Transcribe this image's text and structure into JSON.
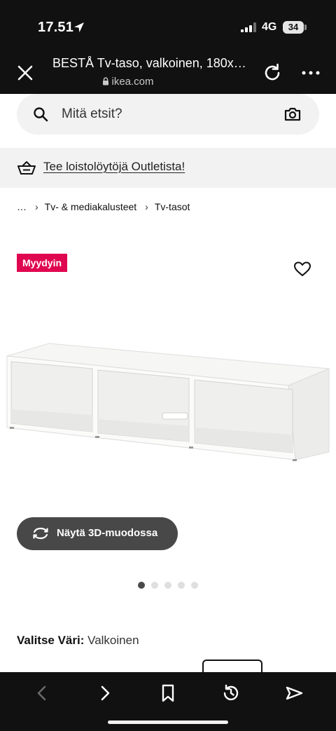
{
  "status_bar": {
    "time": "17.51",
    "network": "4G",
    "battery": "34"
  },
  "browser": {
    "title": "BESTÅ Tv-taso, valkoinen, 180x…",
    "domain": "ikea.com"
  },
  "search": {
    "placeholder": "Mitä etsit?"
  },
  "outlet_banner": {
    "text": "Tee loistolöytöjä Outletista!"
  },
  "breadcrumb": [
    "…",
    "Tv- & mediakalusteet",
    "Tv-tasot"
  ],
  "badge": "Myydyin",
  "view_3d": {
    "label": "Näytä 3D-muodossa"
  },
  "carousel": {
    "count": 5,
    "active_index": 0
  },
  "color": {
    "label": "Valitse Väri:",
    "value": "Valkoinen"
  },
  "colors": {
    "badge": "#e00751",
    "button": "#484848",
    "bars": "#111111"
  }
}
